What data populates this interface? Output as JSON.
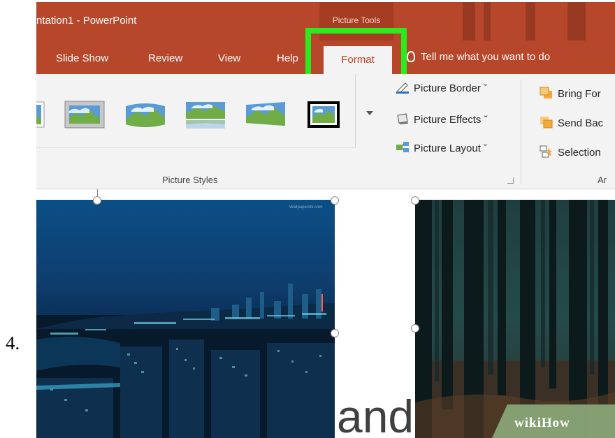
{
  "step_number": "4.",
  "window": {
    "title": "ntation1  -  PowerPoint",
    "context_group": "Picture Tools"
  },
  "tabs": [
    {
      "label": "Slide Show"
    },
    {
      "label": "Review"
    },
    {
      "label": "View"
    },
    {
      "label": "Help"
    },
    {
      "label": "Format",
      "active": true
    }
  ],
  "tell_me": "Tell me what you want to do",
  "ribbon": {
    "picture_styles_label": "Picture Styles",
    "commands": {
      "picture_border": "Picture Border ˇ",
      "picture_effects": "Picture Effects ˇ",
      "picture_layout": "Picture Layout ˇ"
    },
    "arrange": {
      "bring_forward": "Bring For",
      "send_backward": "Send Bac",
      "selection_pane": "Selection",
      "group_label": "Ar"
    }
  },
  "slide": {
    "text": "and"
  },
  "watermark": "wikiHow",
  "colors": {
    "accent": "#b7472a",
    "highlight": "#2bea1d",
    "active_tab_text": "#c43e1c",
    "ribbon_bg": "#f3f3f3"
  }
}
